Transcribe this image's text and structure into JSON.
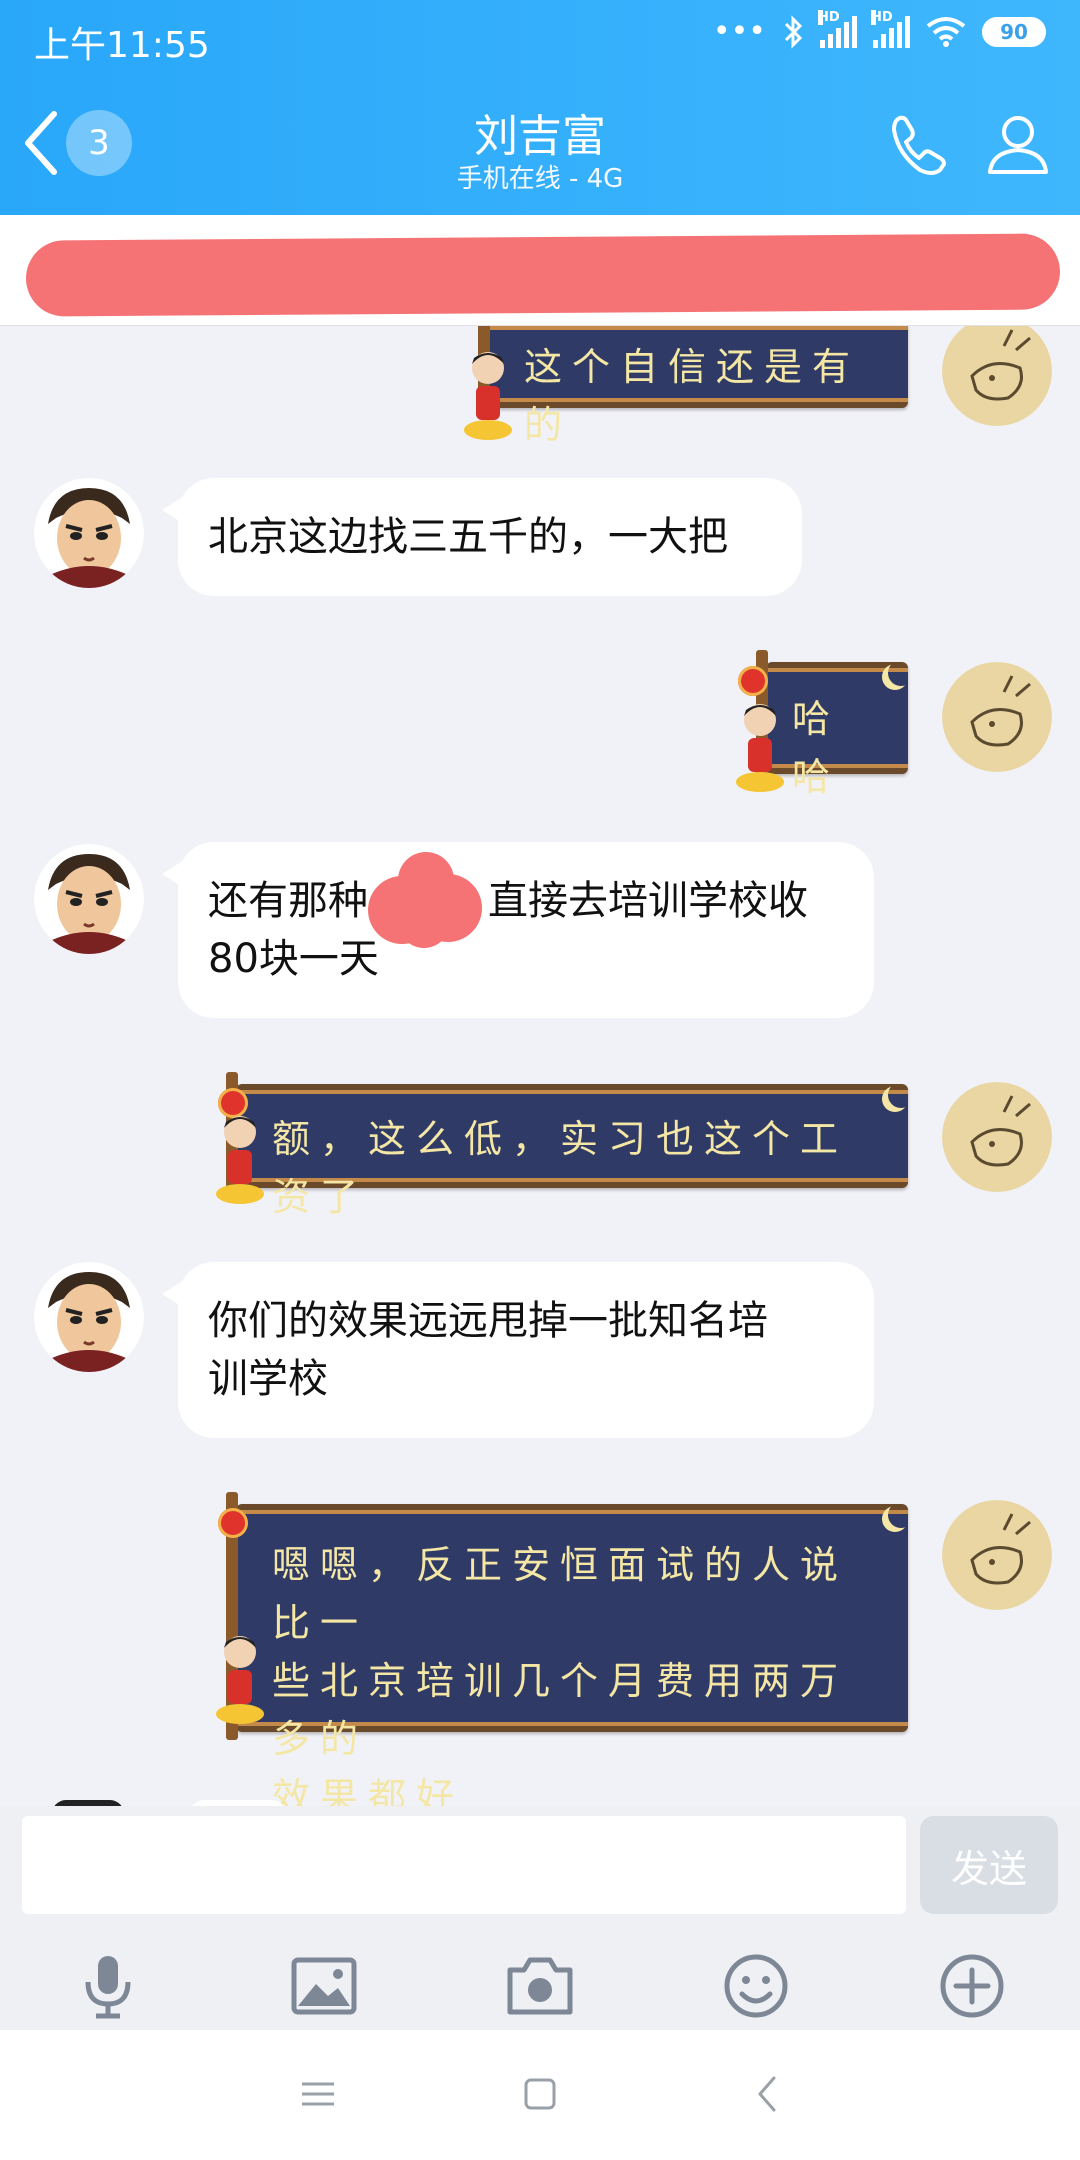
{
  "status_bar": {
    "time": "上午11:55",
    "signal_label": "HD",
    "battery": "90"
  },
  "header": {
    "unread_count": "3",
    "title": "刘吉富",
    "subtitle": "手机在线 - 4G"
  },
  "messages": [
    {
      "from": "me",
      "text": "这个自信还是有的"
    },
    {
      "from": "peer",
      "text": "北京这边找三五千的，一大把"
    },
    {
      "from": "me",
      "text": "哈哈"
    },
    {
      "from": "peer",
      "text": "还有那种",
      "text_after": "直接去培训学校收",
      "line2": "80块一天"
    },
    {
      "from": "me",
      "text": "额，这么低，实习也这个工资了"
    },
    {
      "from": "peer",
      "text": "你们的效果远远甩掉一批知名培",
      "line2": "训学校"
    },
    {
      "from": "me",
      "text": "嗯嗯，反正安恒面试的人说比一",
      "line2": "些北京培训几个月费用两万多的",
      "line3": "效果都好"
    }
  ],
  "input": {
    "placeholder": "",
    "send_label": "发送"
  },
  "toolbar": [
    "microphone-icon",
    "image-icon",
    "camera-icon",
    "emoji-icon",
    "plus-icon"
  ],
  "nav": [
    "menu-icon",
    "home-icon",
    "back-icon"
  ],
  "colors": {
    "header": "#29a7f9",
    "scroll_bg": "#2f3a66",
    "scroll_text": "#f4e7a6",
    "redaction": "#f57374"
  }
}
